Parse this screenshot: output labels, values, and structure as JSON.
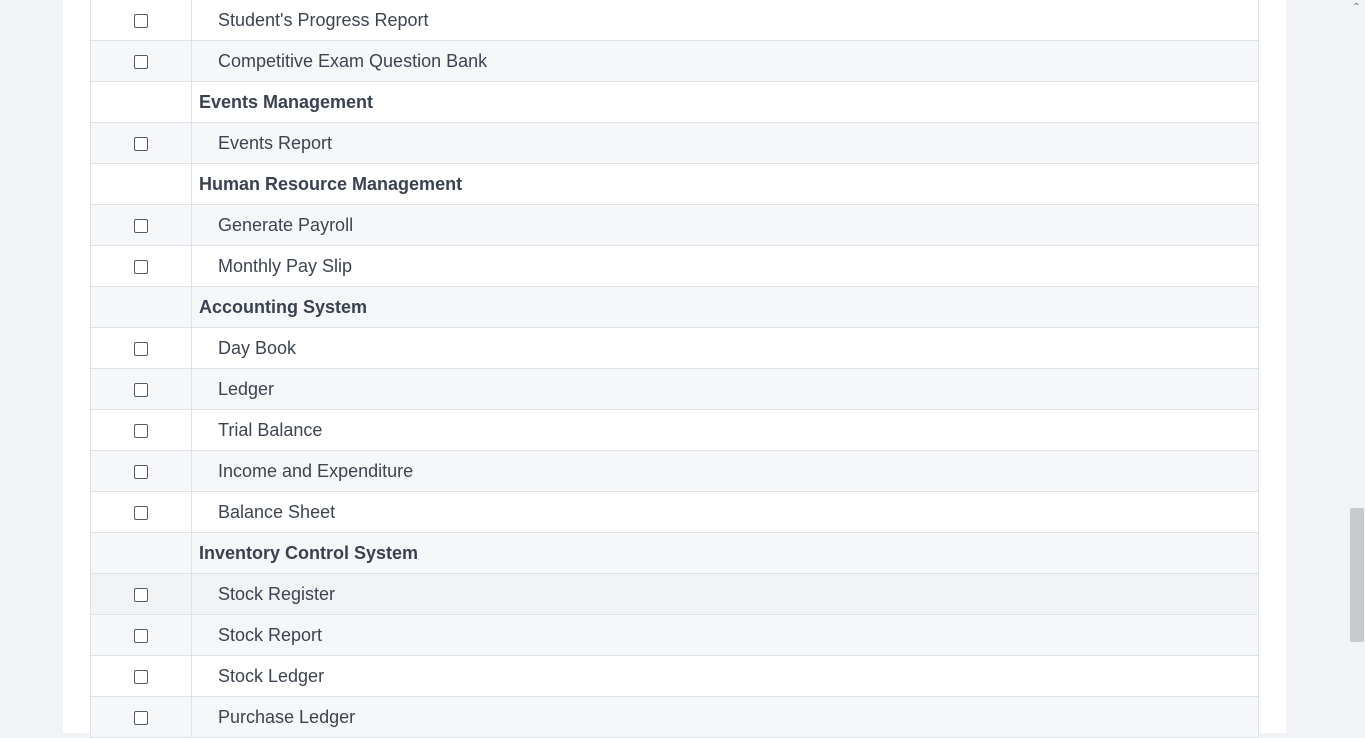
{
  "permissions": {
    "rows": [
      {
        "type": "item",
        "label": "Student's Progress Report"
      },
      {
        "type": "item",
        "label": "Competitive Exam Question Bank"
      },
      {
        "type": "group",
        "label": "Events Management"
      },
      {
        "type": "item",
        "label": "Events Report"
      },
      {
        "type": "group",
        "label": "Human Resource Management"
      },
      {
        "type": "item",
        "label": "Generate Payroll"
      },
      {
        "type": "item",
        "label": "Monthly Pay Slip"
      },
      {
        "type": "group",
        "label": "Accounting System"
      },
      {
        "type": "item",
        "label": "Day Book"
      },
      {
        "type": "item",
        "label": "Ledger"
      },
      {
        "type": "item",
        "label": "Trial Balance"
      },
      {
        "type": "item",
        "label": "Income and Expenditure"
      },
      {
        "type": "item",
        "label": "Balance Sheet"
      },
      {
        "type": "group",
        "label": "Inventory Control System"
      },
      {
        "type": "item",
        "label": "Stock Register"
      },
      {
        "type": "item",
        "label": "Stock Report"
      },
      {
        "type": "item",
        "label": "Stock Ledger"
      },
      {
        "type": "item",
        "label": "Purchase Ledger"
      }
    ]
  },
  "scrollbar": {
    "up_icon": "chevron-up-icon"
  }
}
